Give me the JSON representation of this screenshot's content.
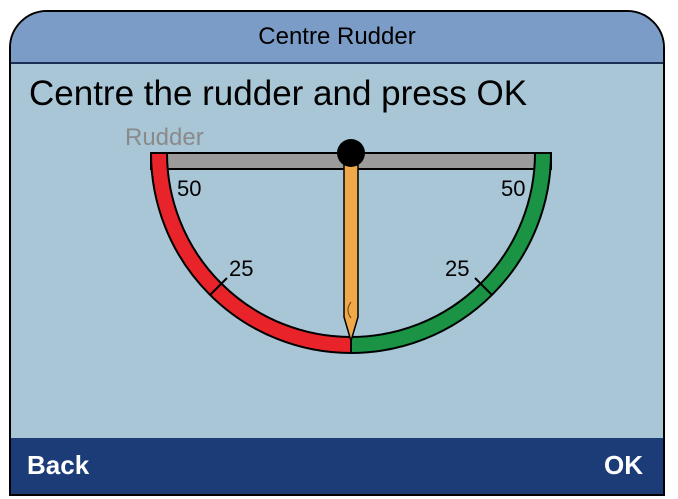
{
  "window": {
    "title": "Centre Rudder"
  },
  "instruction": "Centre the rudder and press OK",
  "gauge": {
    "label": "Rudder",
    "left_ticks": [
      "50",
      "25"
    ],
    "right_ticks": [
      "50",
      "25"
    ],
    "rudder_position": 0,
    "port_color": "#e8232a",
    "starboard_color": "#1a9444",
    "needle_color": "#f0a94a"
  },
  "softkeys": {
    "back": "Back",
    "ok": "OK"
  }
}
